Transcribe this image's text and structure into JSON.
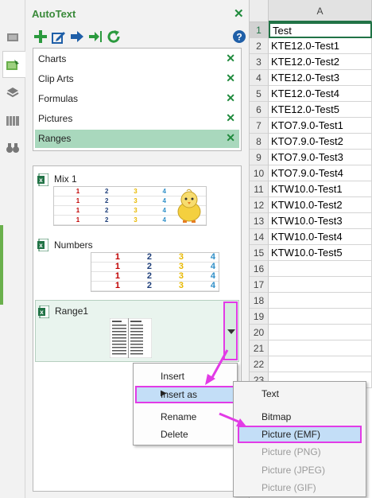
{
  "pane": {
    "title": "AutoText"
  },
  "categories": [
    {
      "label": "Charts"
    },
    {
      "label": "Clip Arts"
    },
    {
      "label": "Formulas"
    },
    {
      "label": "Pictures"
    },
    {
      "label": "Ranges",
      "selected": true
    }
  ],
  "entries": {
    "mix": {
      "name": "Mix 1",
      "rows": [
        [
          "1",
          "2",
          "3",
          "4"
        ],
        [
          "1",
          "2",
          "3",
          "4"
        ],
        [
          "1",
          "2",
          "3",
          "4"
        ],
        [
          "1",
          "2",
          "3",
          "4"
        ]
      ]
    },
    "numbers": {
      "name": "Numbers",
      "rows": [
        [
          "1",
          "2",
          "3",
          "4"
        ],
        [
          "1",
          "2",
          "3",
          "4"
        ],
        [
          "1",
          "2",
          "3",
          "4"
        ],
        [
          "1",
          "2",
          "3",
          "4"
        ]
      ]
    },
    "range": {
      "name": "Range1"
    }
  },
  "sheet": {
    "column": "A",
    "rows": [
      {
        "n": "1",
        "v": "Test"
      },
      {
        "n": "2",
        "v": "KTE12.0-Test1"
      },
      {
        "n": "3",
        "v": "KTE12.0-Test2"
      },
      {
        "n": "4",
        "v": "KTE12.0-Test3"
      },
      {
        "n": "5",
        "v": "KTE12.0-Test4"
      },
      {
        "n": "6",
        "v": "KTE12.0-Test5"
      },
      {
        "n": "7",
        "v": "KTO7.9.0-Test1"
      },
      {
        "n": "8",
        "v": "KTO7.9.0-Test2"
      },
      {
        "n": "9",
        "v": "KTO7.9.0-Test3"
      },
      {
        "n": "10",
        "v": "KTO7.9.0-Test4"
      },
      {
        "n": "11",
        "v": "KTW10.0-Test1"
      },
      {
        "n": "12",
        "v": "KTW10.0-Test2"
      },
      {
        "n": "13",
        "v": "KTW10.0-Test3"
      },
      {
        "n": "14",
        "v": "KTW10.0-Test4"
      },
      {
        "n": "15",
        "v": "KTW10.0-Test5"
      },
      {
        "n": "16",
        "v": ""
      },
      {
        "n": "17",
        "v": ""
      },
      {
        "n": "18",
        "v": ""
      },
      {
        "n": "19",
        "v": ""
      },
      {
        "n": "20",
        "v": ""
      },
      {
        "n": "21",
        "v": ""
      },
      {
        "n": "22",
        "v": ""
      },
      {
        "n": "23",
        "v": ""
      }
    ]
  },
  "context_menu": {
    "insert": "Insert",
    "insert_as": "Insert as",
    "rename": "Rename",
    "delete": "Delete"
  },
  "submenu": {
    "text": "Text",
    "bitmap": "Bitmap",
    "picture_emf": "Picture (EMF)",
    "picture_png": "Picture (PNG)",
    "picture_jpeg": "Picture (JPEG)",
    "picture_gif": "Picture (GIF)"
  },
  "colors": {
    "accent_green": "#1f8a3c",
    "selected_row": "#a9d8bd",
    "highlight_border": "#e23be6",
    "menu_highlight": "#c3def7",
    "excel_green": "#217346"
  }
}
